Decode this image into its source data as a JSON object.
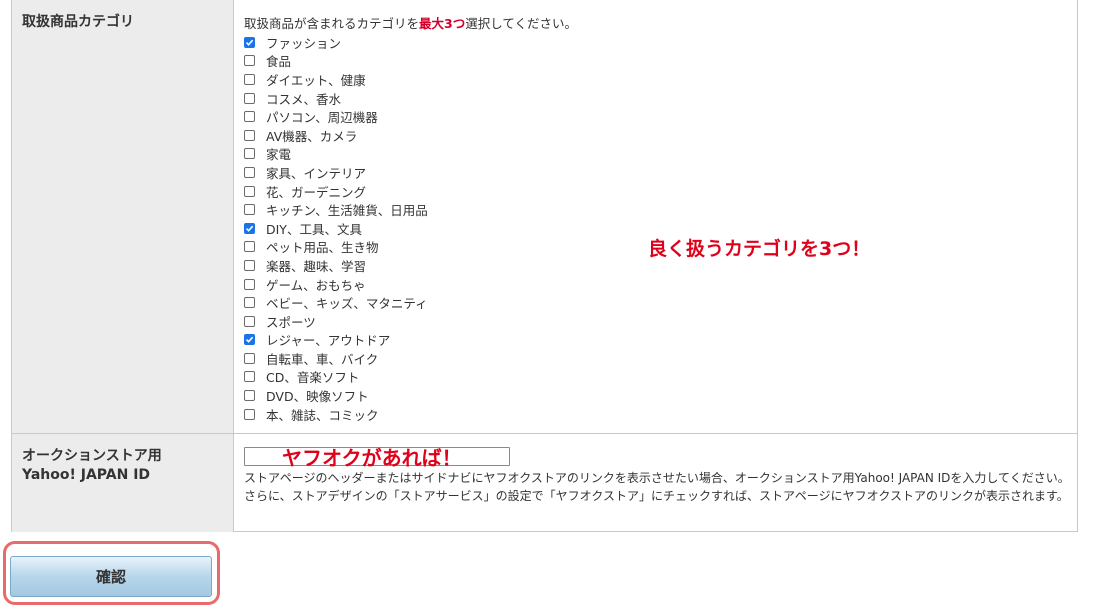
{
  "category_section": {
    "label": "取扱商品カテゴリ",
    "intro_before": "取扱商品が含まれるカテゴリを",
    "intro_emphasis": "最大3つ",
    "intro_after": "選択してください。",
    "items": [
      {
        "label": "ファッション",
        "checked": true
      },
      {
        "label": "食品",
        "checked": false
      },
      {
        "label": "ダイエット、健康",
        "checked": false
      },
      {
        "label": "コスメ、香水",
        "checked": false
      },
      {
        "label": "パソコン、周辺機器",
        "checked": false
      },
      {
        "label": "AV機器、カメラ",
        "checked": false
      },
      {
        "label": "家電",
        "checked": false
      },
      {
        "label": "家具、インテリア",
        "checked": false
      },
      {
        "label": "花、ガーデニング",
        "checked": false
      },
      {
        "label": "キッチン、生活雑貨、日用品",
        "checked": false
      },
      {
        "label": "DIY、工具、文具",
        "checked": true
      },
      {
        "label": "ペット用品、生き物",
        "checked": false
      },
      {
        "label": "楽器、趣味、学習",
        "checked": false
      },
      {
        "label": "ゲーム、おもちゃ",
        "checked": false
      },
      {
        "label": "ベビー、キッズ、マタニティ",
        "checked": false
      },
      {
        "label": "スポーツ",
        "checked": false
      },
      {
        "label": "レジャー、アウトドア",
        "checked": true
      },
      {
        "label": "自転車、車、バイク",
        "checked": false
      },
      {
        "label": "CD、音楽ソフト",
        "checked": false
      },
      {
        "label": "DVD、映像ソフト",
        "checked": false
      },
      {
        "label": "本、雑誌、コミック",
        "checked": false
      }
    ],
    "annotation": "良く扱うカテゴリを3つ！"
  },
  "auction_section": {
    "label_line1": "オークションストア用",
    "label_line2": "Yahoo! JAPAN ID",
    "input_value": "",
    "annotation": "ヤフオクがあれば！",
    "help_text": "ストアページのヘッダーまたはサイドナビにヤフオクストアのリンクを表示させたい場合、オークションストア用Yahoo! JAPAN IDを入力してください。さらに、ストアデザインの「ストアサービス」の設定で「ヤフオクストア」にチェックすれば、ストアページにヤフオクストアのリンクが表示されます。"
  },
  "confirm_button": {
    "label": "確認"
  },
  "colors": {
    "accent_red": "#e0001a",
    "checkbox_checked": "#1a73e8",
    "header_bg": "#ececec",
    "highlight_ring": "#e86a6a"
  }
}
